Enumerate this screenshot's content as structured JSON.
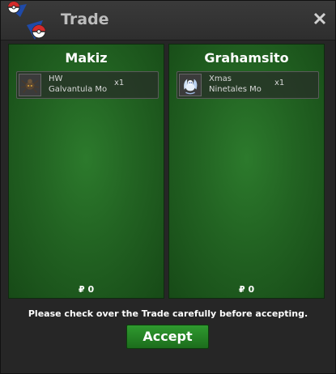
{
  "window": {
    "title": "Trade"
  },
  "left_panel": {
    "player_name": "Makiz",
    "item": {
      "line1": "HW",
      "line2": "Galvantula Mo",
      "quantity": "x1",
      "icon": "spider-icon"
    },
    "money": "₽ 0"
  },
  "right_panel": {
    "player_name": "Grahamsito",
    "item": {
      "line1": "Xmas",
      "line2": "Ninetales Mo",
      "quantity": "x1",
      "icon": "fox-icon"
    },
    "money": "₽ 0"
  },
  "footer": {
    "notice": "Please check over the Trade carefully before accepting.",
    "accept_label": "Accept"
  },
  "colors": {
    "panel_green": "#226322",
    "button_green": "#2f9a2f",
    "title_gray": "#bdbdbd"
  }
}
